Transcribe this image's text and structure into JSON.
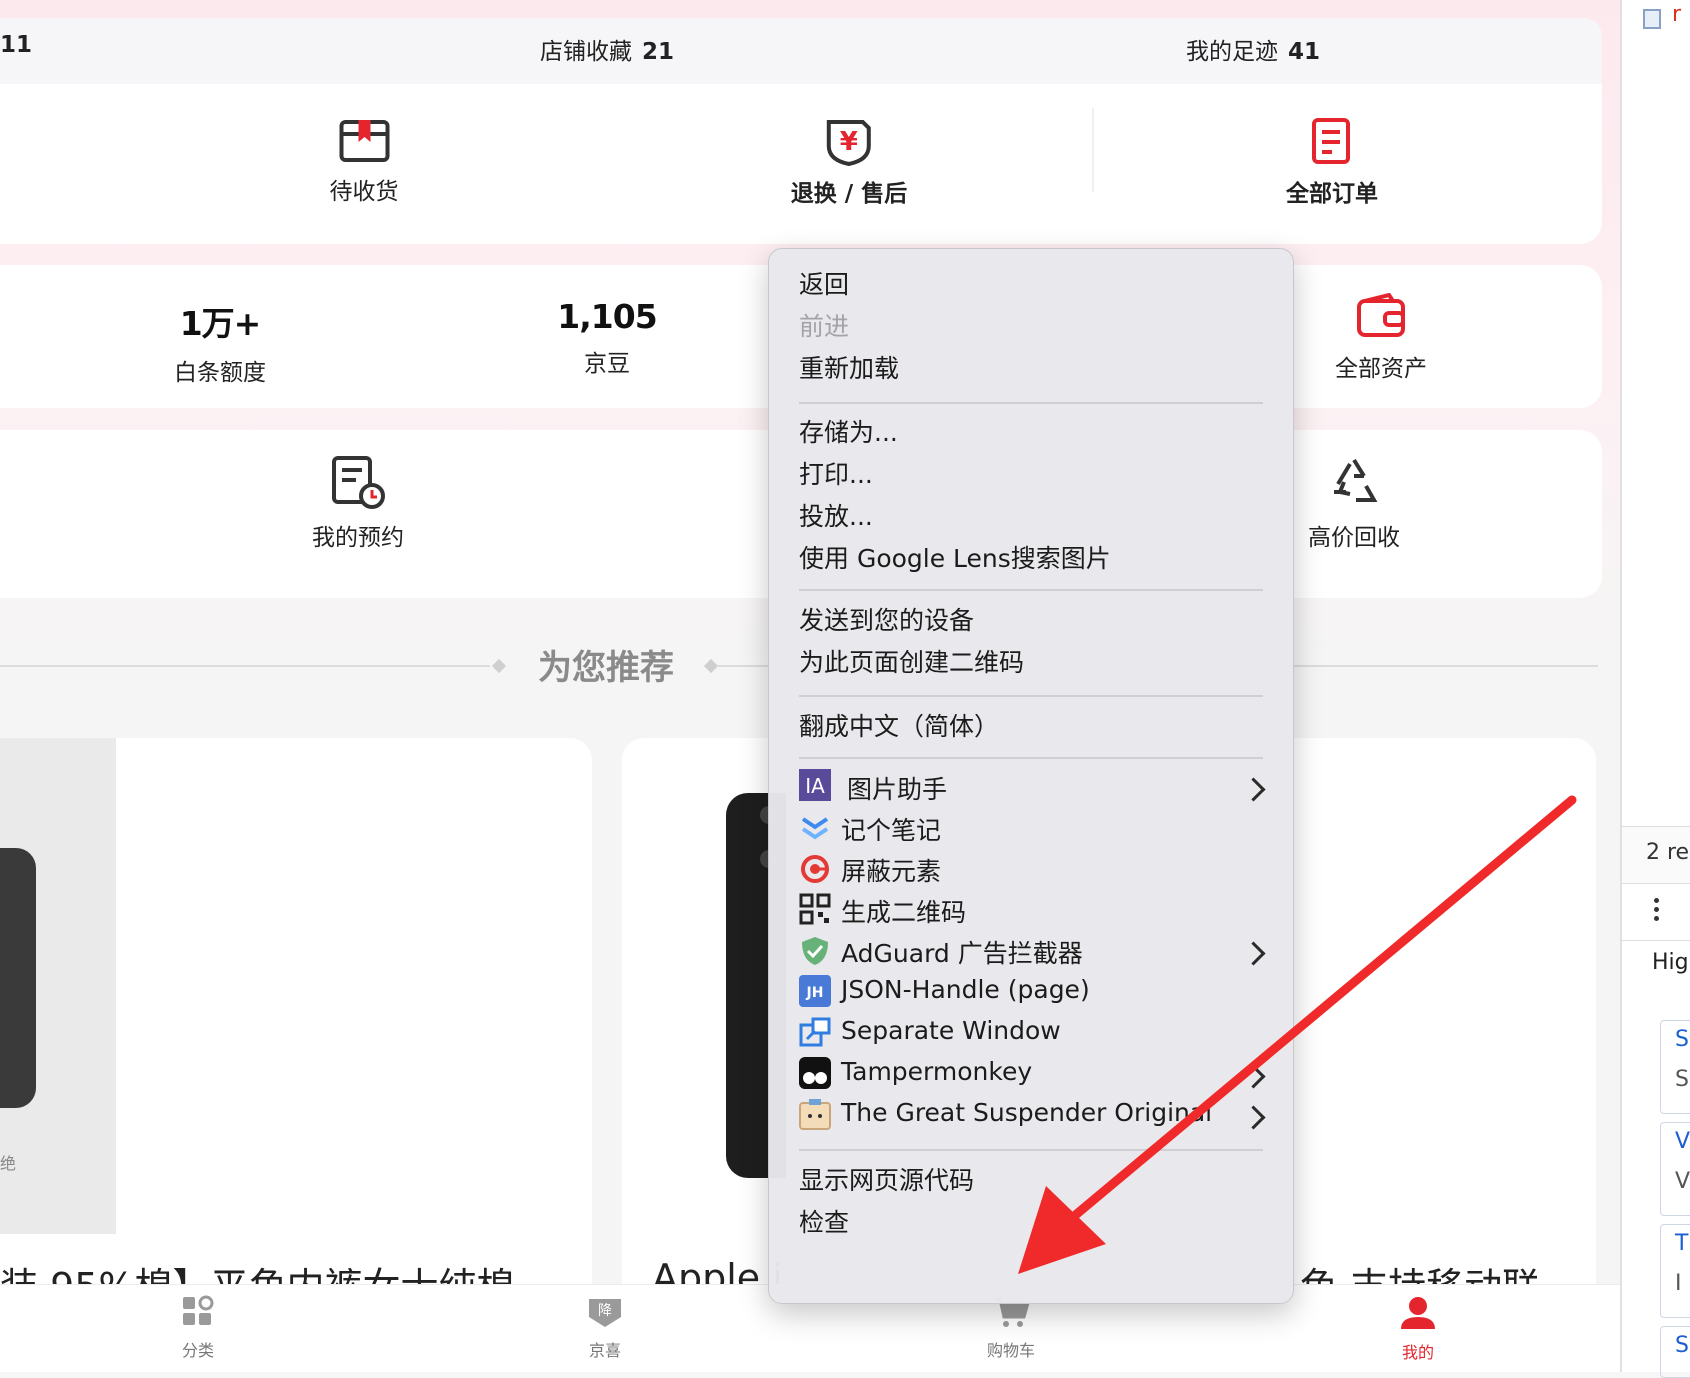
{
  "stats": [
    {
      "label": "",
      "value": "11"
    },
    {
      "label": "店铺收藏",
      "value": "21"
    },
    {
      "label": "我的足迹",
      "value": "41"
    }
  ],
  "orders": [
    {
      "label": "待收货",
      "icon": "package-icon"
    },
    {
      "label": "退换 / 售后",
      "icon": "refund-icon"
    },
    {
      "label": "全部订单",
      "icon": "order-list-icon"
    }
  ],
  "assets": [
    {
      "value": "1万+",
      "label": "白条额度"
    },
    {
      "value": "1,105",
      "label": "京豆"
    },
    {
      "label": "全部资产",
      "icon": "wallet-icon"
    }
  ],
  "services": [
    {
      "label": "我的预约",
      "icon": "appointment-icon"
    },
    {
      "label": "高价回收",
      "icon": "recycle-icon"
    }
  ],
  "recommend": {
    "title": "为您推荐"
  },
  "products": [
    {
      "title": "装 95%棉】平角内裤女士纯棉"
    },
    {
      "title": "Apple i"
    },
    {
      "title": "色 支持移动联"
    }
  ],
  "left_caption": "绝",
  "tabbar": [
    {
      "label": "分类",
      "icon": "category-icon"
    },
    {
      "label": "京喜",
      "icon": "jingxi-icon"
    },
    {
      "label": "购物车",
      "icon": "cart-icon"
    },
    {
      "label": "我的",
      "icon": "profile-icon",
      "active": true
    }
  ],
  "context_menu": {
    "nav": [
      "返回",
      "前进",
      "重新加载"
    ],
    "page_actions": [
      "存储为...",
      "打印...",
      "投放...",
      "使用 Google Lens搜索图片"
    ],
    "share": [
      "发送到您的设备",
      "为此页面创建二维码"
    ],
    "translate": "翻成中文（简体）",
    "extensions": [
      {
        "label": "图片助手",
        "icon": "image-assistant-icon",
        "submenu": true
      },
      {
        "label": "记个笔记",
        "icon": "note-icon",
        "submenu": false
      },
      {
        "label": "屏蔽元素",
        "icon": "block-element-icon",
        "submenu": false
      },
      {
        "label": "生成二维码",
        "icon": "qrcode-icon",
        "submenu": false
      },
      {
        "label": "AdGuard 广告拦截器",
        "icon": "adguard-icon",
        "submenu": true
      },
      {
        "label": "JSON-Handle (page)",
        "icon": "json-handle-icon",
        "submenu": false
      },
      {
        "label": "Separate Window",
        "icon": "separate-window-icon",
        "submenu": false
      },
      {
        "label": "Tampermonkey",
        "icon": "tampermonkey-icon",
        "submenu": true
      },
      {
        "label": "The Great Suspender Original",
        "icon": "suspender-icon",
        "submenu": true
      }
    ],
    "dev": [
      "显示网页源代码",
      "检查"
    ]
  },
  "sidebar": {
    "top": "r",
    "count": "2 re",
    "section": "Hig",
    "items": [
      "S",
      "S",
      "V",
      "V",
      "T",
      "I",
      "S"
    ]
  },
  "colors": {
    "accent": "#e4252e",
    "arrow": "#f02a2a"
  }
}
